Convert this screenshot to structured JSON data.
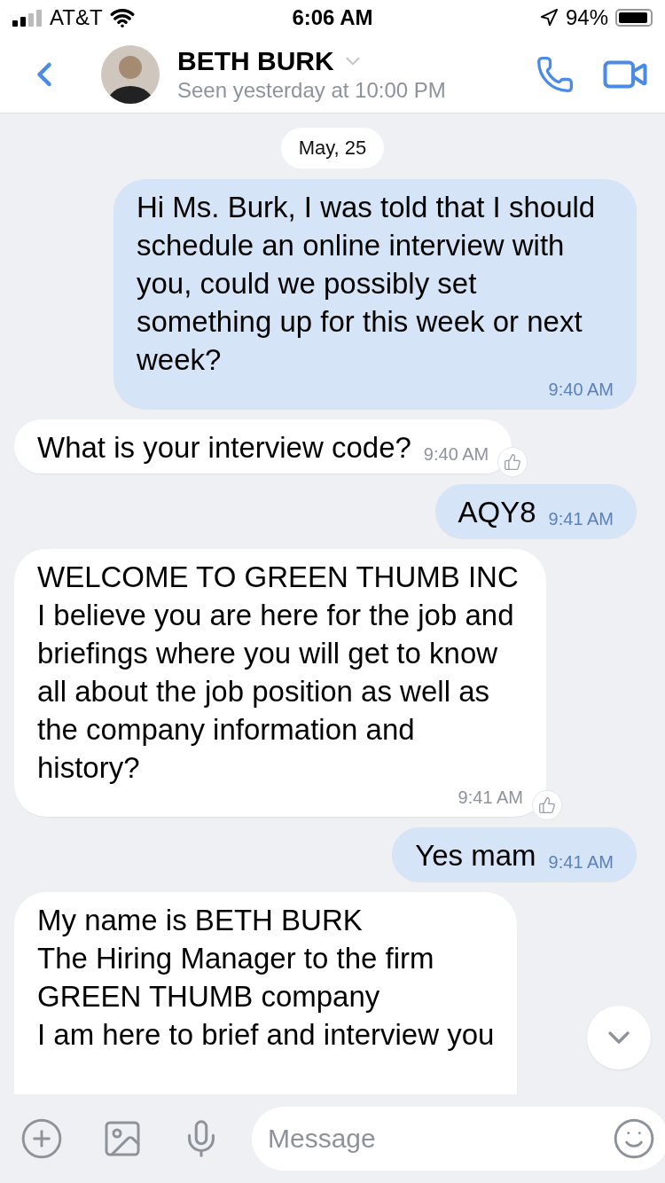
{
  "status_bar": {
    "carrier": "AT&T",
    "time": "6:06 AM",
    "battery": "94%"
  },
  "header": {
    "name": "BETH BURK",
    "subtitle": "Seen yesterday at 10:00 PM"
  },
  "date_chip": "May, 25",
  "messages": [
    {
      "kind": "outgoing",
      "text": "Hi Ms. Burk, I was told that I should schedule an online interview with you, could we possibly set something up for this week or next week?",
      "time": "9:40 AM"
    },
    {
      "kind": "incoming",
      "text": "What is your interview code?",
      "time": "9:40 AM"
    },
    {
      "kind": "outgoing",
      "text": "AQY8",
      "time": "9:41 AM"
    },
    {
      "kind": "incoming",
      "text": "WELCOME TO GREEN THUMB INC\nI believe you are here for the job and briefings where you will get to know all about the job position as well as the company information and history?",
      "time": "9:41 AM"
    },
    {
      "kind": "outgoing",
      "text": "Yes mam",
      "time": "9:41 AM"
    },
    {
      "kind": "incoming",
      "text": "My name is BETH BURK\nThe Hiring Manager to the firm\nGREEN THUMB company\nI am here to brief and interview you"
    }
  ],
  "composer": {
    "placeholder": "Message"
  }
}
